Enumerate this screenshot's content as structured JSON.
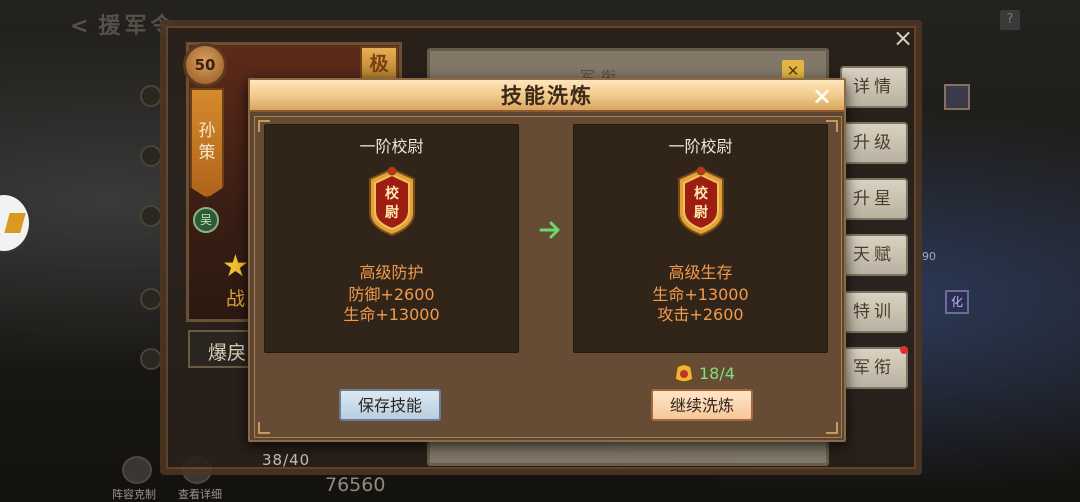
{
  "background": {
    "page_title": "援军令",
    "back_icon": "back-arrow-icon",
    "help_icon": "help-icon",
    "outer_close": "×",
    "hero": {
      "level": "50",
      "name": "孙策",
      "camp": "吴",
      "role": "战",
      "top_badge": "极",
      "skill_tag": "爆戾",
      "progress": "38/40",
      "power": "76560"
    },
    "army_tab": "军衔",
    "side_buttons": [
      "详情",
      "升级",
      "升星",
      "天赋",
      "特训",
      "军衔"
    ],
    "right_edge_label": "90",
    "right_edge_icon": "化",
    "bottom_labels": [
      "阵容克制",
      "查看详细"
    ]
  },
  "dialog": {
    "title": "技能洗炼",
    "close_label": "×",
    "current": {
      "rank": "一阶校尉",
      "emblem_text": [
        "校",
        "尉"
      ],
      "skill_name": "高级防护",
      "stats": [
        "防御+2600",
        "生命+13000"
      ]
    },
    "next": {
      "rank": "一阶校尉",
      "emblem_text": [
        "校",
        "尉"
      ],
      "skill_name": "高级生存",
      "stats": [
        "生命+13000",
        "攻击+2600"
      ]
    },
    "arrow_icon": "right-arrow-icon",
    "arrow_color": "#6fd66a",
    "cost": {
      "icon": "refine-token-icon",
      "value": "18/4",
      "color": "#7ee07a"
    },
    "save_button": "保存技能",
    "refine_button": "继续洗炼"
  }
}
